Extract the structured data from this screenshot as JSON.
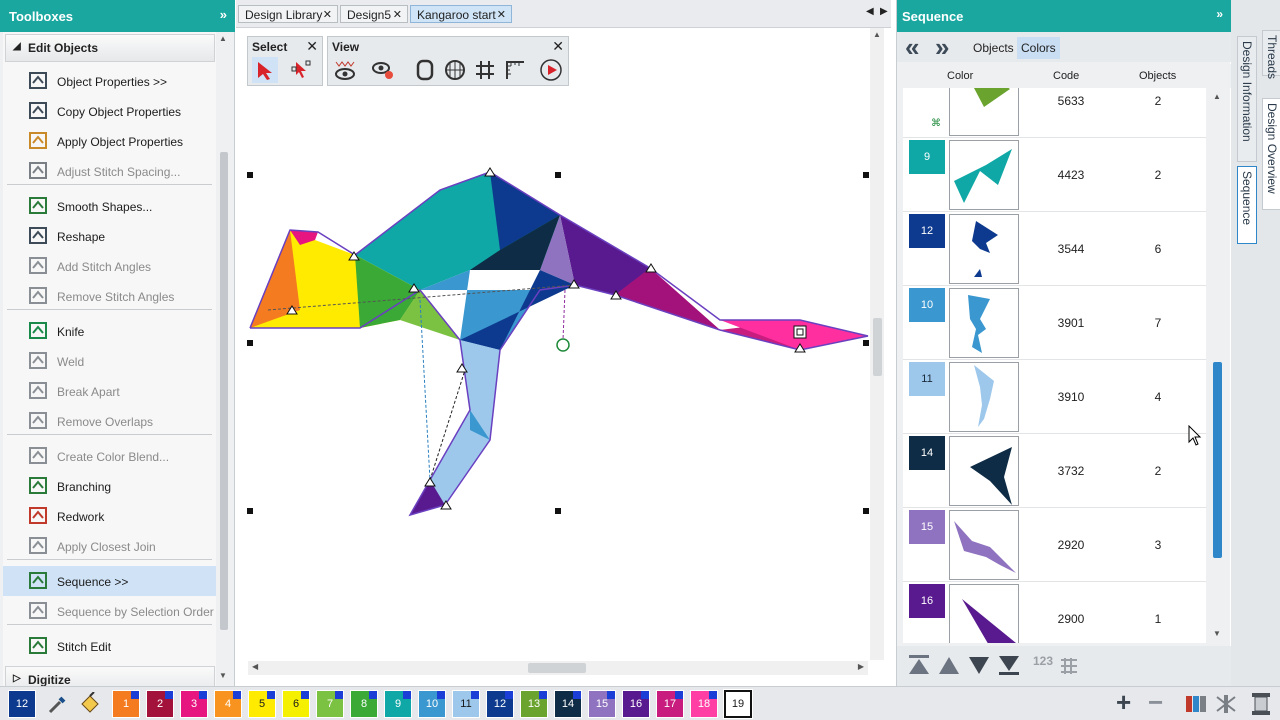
{
  "left_panel": {
    "title": "Toolboxes",
    "section_edit": "Edit Objects",
    "section_digitize": "Digitize",
    "tools": [
      {
        "label": "Object Properties >>",
        "disabled": false
      },
      {
        "label": "Copy Object Properties",
        "disabled": false
      },
      {
        "label": "Apply Object Properties",
        "disabled": false
      },
      {
        "label": "Adjust Stitch Spacing...",
        "disabled": true
      },
      {
        "label": "Smooth Shapes...",
        "disabled": false
      },
      {
        "label": "Reshape",
        "disabled": false
      },
      {
        "label": "Add Stitch Angles",
        "disabled": true
      },
      {
        "label": "Remove Stitch Angles",
        "disabled": true
      },
      {
        "label": "Knife",
        "disabled": false
      },
      {
        "label": "Weld",
        "disabled": true
      },
      {
        "label": "Break Apart",
        "disabled": true
      },
      {
        "label": "Remove Overlaps",
        "disabled": true
      },
      {
        "label": "Create Color Blend...",
        "disabled": true
      },
      {
        "label": "Branching",
        "disabled": false
      },
      {
        "label": "Redwork",
        "disabled": false
      },
      {
        "label": "Apply Closest Join",
        "disabled": true
      },
      {
        "label": "Sequence >>",
        "disabled": false,
        "selected": true
      },
      {
        "label": "Sequence by Selection Order",
        "disabled": true
      },
      {
        "label": "Stitch Edit",
        "disabled": false
      }
    ]
  },
  "tabs": [
    {
      "label": "Design Library"
    },
    {
      "label": "Design5"
    },
    {
      "label": "Kangaroo start",
      "active": true
    }
  ],
  "toolbar_select": {
    "title": "Select"
  },
  "toolbar_view": {
    "title": "View"
  },
  "right_panel": {
    "title": "Sequence",
    "seg_objects": "Objects",
    "seg_colors": "Colors",
    "col_color": "Color",
    "col_code": "Code",
    "col_objects": "Objects",
    "rows": [
      {
        "num": "",
        "swatch": "#6aa32d",
        "code": "5633",
        "objects": "2"
      },
      {
        "num": "9",
        "swatch": "#10a8a6",
        "code": "4423",
        "objects": "2"
      },
      {
        "num": "12",
        "swatch": "#0d3a8e",
        "code": "3544",
        "objects": "6"
      },
      {
        "num": "10",
        "swatch": "#3a97cf",
        "code": "3901",
        "objects": "7"
      },
      {
        "num": "11",
        "swatch": "#9dc8ec",
        "code": "3910",
        "objects": "4"
      },
      {
        "num": "14",
        "swatch": "#0e2c45",
        "code": "3732",
        "objects": "2"
      },
      {
        "num": "15",
        "swatch": "#8f73c0",
        "code": "2920",
        "objects": "3"
      },
      {
        "num": "16",
        "swatch": "#5a1a8f",
        "code": "2900",
        "objects": "1"
      }
    ],
    "footer_label": "123"
  },
  "side_tabs": [
    "Threads",
    "Design Information",
    "Design Overview",
    "Sequence"
  ],
  "palette": [
    {
      "label": "12",
      "color": "#0d3a8e",
      "mark": false,
      "current": false
    },
    {
      "label": "1",
      "color": "#f47b20",
      "mark": true
    },
    {
      "label": "2",
      "color": "#a3123a",
      "mark": true
    },
    {
      "label": "3",
      "color": "#e6157f",
      "mark": true
    },
    {
      "label": "4",
      "color": "#f7931e",
      "mark": true
    },
    {
      "label": "5",
      "color": "#ffeb00",
      "mark": true
    },
    {
      "label": "6",
      "color": "#f5f000",
      "mark": true
    },
    {
      "label": "7",
      "color": "#7cc242",
      "mark": true
    },
    {
      "label": "8",
      "color": "#3aa935",
      "mark": true
    },
    {
      "label": "9",
      "color": "#10a8a6",
      "mark": true
    },
    {
      "label": "10",
      "color": "#3a97cf",
      "mark": true
    },
    {
      "label": "11",
      "color": "#9dc8ec",
      "mark": true
    },
    {
      "label": "12",
      "color": "#0d3a8e",
      "mark": true
    },
    {
      "label": "13",
      "color": "#6aa32d",
      "mark": true
    },
    {
      "label": "14",
      "color": "#0e2c45",
      "mark": true
    },
    {
      "label": "15",
      "color": "#8f73c0",
      "mark": true
    },
    {
      "label": "16",
      "color": "#5a1a8f",
      "mark": true
    },
    {
      "label": "17",
      "color": "#c81d7e",
      "mark": true
    },
    {
      "label": "18",
      "color": "#ff3fa4",
      "mark": true
    },
    {
      "label": "19",
      "color": "#ffffff",
      "mark": false,
      "current": true
    }
  ]
}
